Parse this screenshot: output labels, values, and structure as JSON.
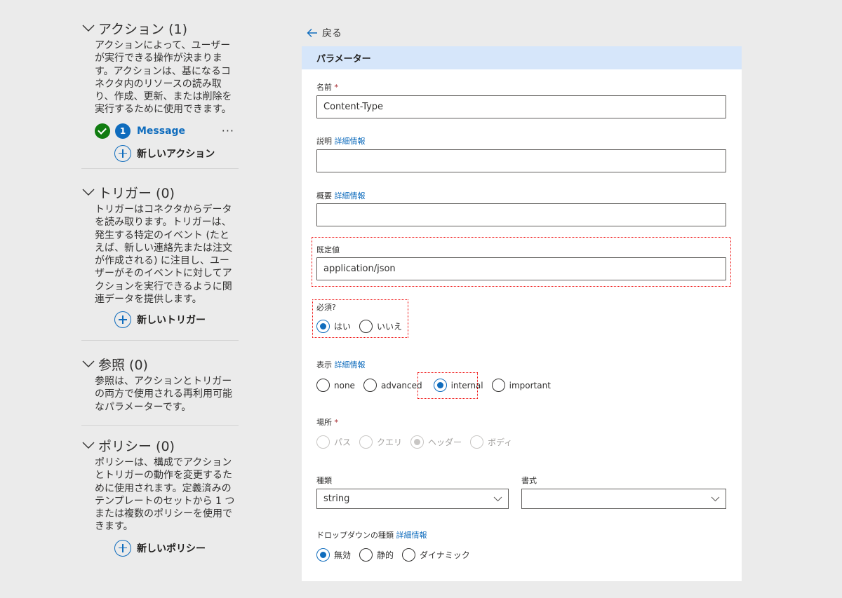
{
  "left": {
    "sections": [
      {
        "title": "アクション (1)",
        "description": "アクションによって、ユーザーが実行できる操作が決まります。アクションは、基になるコネクタ内のリソースの読み取り、作成、更新、または削除を実行するために使用できます。",
        "action": {
          "status": "✓",
          "number": "1",
          "name": "Message",
          "more": "···"
        },
        "add_label": "新しいアクション"
      },
      {
        "title": "トリガー (0)",
        "description": "トリガーはコネクタからデータを読み取ります。トリガーは、発生する特定のイベント (たとえば、新しい連絡先または注文が作成される) に注目し、ユーザーがそのイベントに対してアクションを実行できるように関連データを提供します。",
        "add_label": "新しいトリガー"
      },
      {
        "title": "参照 (0)",
        "description": "参照は、アクションとトリガーの両方で使用される再利用可能なパラメーターです。"
      },
      {
        "title": "ポリシー (0)",
        "description": "ポリシーは、構成でアクションとトリガーの動作を変更するために使用されます。定義済みのテンプレートのセットから 1 つまたは複数のポリシーを使用できます。",
        "add_label": "新しいポリシー"
      }
    ]
  },
  "back_label": "戻る",
  "card": {
    "header": "パラメーター",
    "name": {
      "label": "名前",
      "required": "*",
      "value": "Content-Type"
    },
    "description": {
      "label": "説明",
      "link": "詳細情報",
      "value": ""
    },
    "summary": {
      "label": "概要",
      "link": "詳細情報",
      "value": ""
    },
    "default": {
      "label": "既定値",
      "value": "application/json"
    },
    "required": {
      "label": "必須?",
      "options": [
        "はい",
        "いいえ"
      ],
      "selected": "はい"
    },
    "visibility": {
      "label": "表示",
      "link": "詳細情報",
      "options": [
        "none",
        "advanced",
        "internal",
        "important"
      ],
      "selected": "internal"
    },
    "location": {
      "label": "場所",
      "required": "*",
      "options": [
        "パス",
        "クエリ",
        "ヘッダー",
        "ボディ"
      ],
      "selected": "ヘッダー"
    },
    "type": {
      "label": "種類",
      "value": "string"
    },
    "format": {
      "label": "書式",
      "value": ""
    },
    "dropdown_type": {
      "label": "ドロップダウンの種類",
      "link": "詳細情報",
      "options": [
        "無効",
        "静的",
        "ダイナミック"
      ],
      "selected": "無効"
    }
  },
  "colors": {
    "accent": "#0f6cbd",
    "highlight": "#e00000",
    "header_bg": "#d6e6fa",
    "success": "#107c10"
  }
}
